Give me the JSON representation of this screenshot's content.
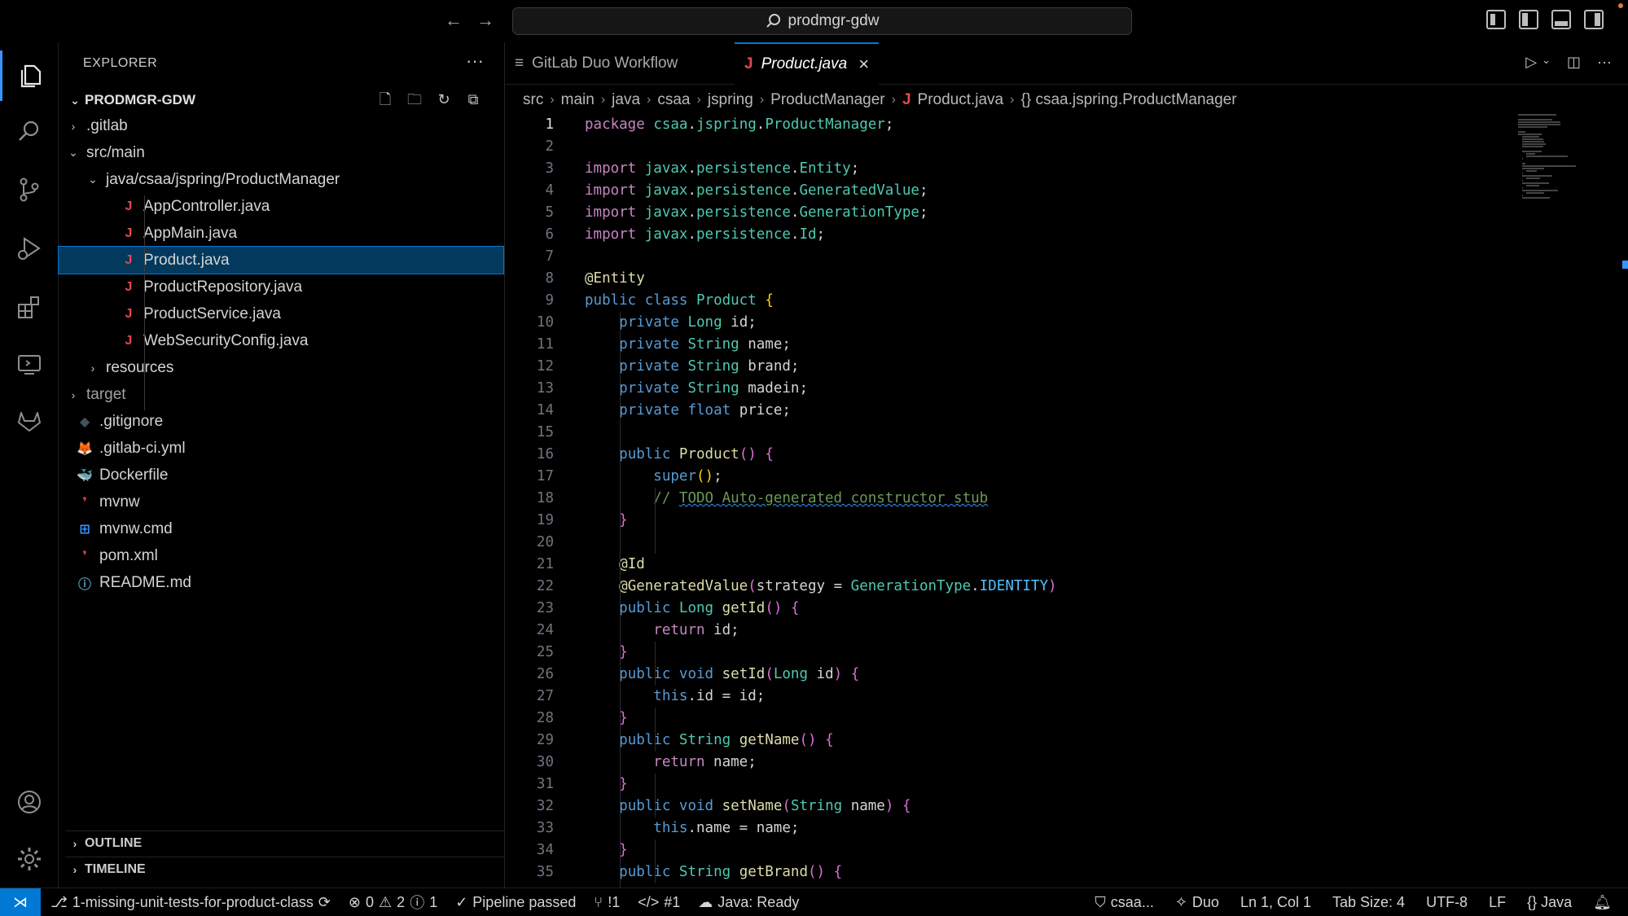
{
  "titlebar": {
    "search_text": "prodmgr-gdw",
    "back": "←",
    "forward": "→"
  },
  "sidebar": {
    "title": "EXPLORER",
    "more": "···",
    "root": "PRODMGR-GDW",
    "tree": [
      {
        "label": ".gitlab",
        "chev": "›",
        "icon": "",
        "icon_color": "",
        "indent": 0,
        "kind": "folder"
      },
      {
        "label": "src/main",
        "chev": "⌄",
        "icon": "",
        "icon_color": "",
        "indent": 0,
        "kind": "folder"
      },
      {
        "label": "java/csaa/jspring/ProductManager",
        "chev": "⌄",
        "icon": "",
        "icon_color": "",
        "indent": 1,
        "kind": "folder"
      },
      {
        "label": "AppController.java",
        "chev": "",
        "icon": "J",
        "icon_color": "#e5484d",
        "indent": 2,
        "kind": "file"
      },
      {
        "label": "AppMain.java",
        "chev": "",
        "icon": "J",
        "icon_color": "#e5484d",
        "indent": 2,
        "kind": "file"
      },
      {
        "label": "Product.java",
        "chev": "",
        "icon": "J",
        "icon_color": "#e5484d",
        "indent": 2,
        "kind": "file",
        "selected": true
      },
      {
        "label": "ProductRepository.java",
        "chev": "",
        "icon": "J",
        "icon_color": "#e5484d",
        "indent": 2,
        "kind": "file"
      },
      {
        "label": "ProductService.java",
        "chev": "",
        "icon": "J",
        "icon_color": "#e5484d",
        "indent": 2,
        "kind": "file"
      },
      {
        "label": "WebSecurityConfig.java",
        "chev": "",
        "icon": "J",
        "icon_color": "#e5484d",
        "indent": 2,
        "kind": "file"
      },
      {
        "label": "resources",
        "chev": "›",
        "icon": "",
        "icon_color": "",
        "indent": 1,
        "kind": "folder"
      },
      {
        "label": "target",
        "chev": "›",
        "icon": "",
        "icon_color": "",
        "indent": 0,
        "kind": "folder",
        "muted": true
      },
      {
        "label": ".gitignore",
        "chev": "",
        "icon": "◆",
        "icon_color": "#41535b",
        "indent": 0,
        "kind": "file"
      },
      {
        "label": ".gitlab-ci.yml",
        "chev": "",
        "icon": "🦊",
        "icon_color": "#e24329",
        "indent": 0,
        "kind": "file"
      },
      {
        "label": "Dockerfile",
        "chev": "",
        "icon": "🐳",
        "icon_color": "#4a90c2",
        "indent": 0,
        "kind": "file"
      },
      {
        "label": "mvnw",
        "chev": "",
        "icon": "❜",
        "icon_color": "#e5484d",
        "indent": 0,
        "kind": "file"
      },
      {
        "label": "mvnw.cmd",
        "chev": "",
        "icon": "⊞",
        "icon_color": "#3794ff",
        "indent": 0,
        "kind": "file"
      },
      {
        "label": "pom.xml",
        "chev": "",
        "icon": "❜",
        "icon_color": "#e5484d",
        "indent": 0,
        "kind": "file"
      },
      {
        "label": "README.md",
        "chev": "",
        "icon": "ⓘ",
        "icon_color": "#519aba",
        "indent": 0,
        "kind": "file"
      }
    ],
    "outline": "OUTLINE",
    "timeline": "TIMELINE"
  },
  "tabs": [
    {
      "label": "GitLab Duo Workflow",
      "icon": "≡",
      "active": false
    },
    {
      "label": "Product.java",
      "icon": "J",
      "active": true
    }
  ],
  "breadcrumb": [
    "src",
    "main",
    "java",
    "csaa",
    "jspring",
    "ProductManager",
    "Product.java",
    "{} csaa.jspring.ProductManager"
  ],
  "code_lines": [
    "<span class='kw2'>package</span> <span class='ty'>csaa</span>.<span class='ty'>jspring</span>.<span class='ty'>ProductManager</span>;",
    "",
    "<span class='kw2'>import</span> <span class='ty'>javax</span>.<span class='ty'>persistence</span>.<span class='ty'>Entity</span>;",
    "<span class='kw2'>import</span> <span class='ty'>javax</span>.<span class='ty'>persistence</span>.<span class='ty'>GeneratedValue</span>;",
    "<span class='kw2'>import</span> <span class='ty'>javax</span>.<span class='ty'>persistence</span>.<span class='ty'>GenerationType</span>;",
    "<span class='kw2'>import</span> <span class='ty'>javax</span>.<span class='ty'>persistence</span>.<span class='ty'>Id</span>;",
    "",
    "<span class='an'>@Entity</span>",
    "<span class='kw'>public</span> <span class='kw'>class</span> <span class='ty'>Product</span> <span class='pu'>{</span>",
    "    <span class='kw'>private</span> <span class='ty'>Long</span> id;",
    "    <span class='kw'>private</span> <span class='ty'>String</span> name;",
    "    <span class='kw'>private</span> <span class='ty'>String</span> brand;",
    "    <span class='kw'>private</span> <span class='ty'>String</span> madein;",
    "    <span class='kw'>private</span> <span class='kw'>float</span> price;",
    "",
    "    <span class='kw'>public</span> <span class='fn'>Product</span><span class='pu2'>()</span> <span class='pu2'>{</span>",
    "        <span class='kw'>super</span><span class='pu'>()</span>;",
    "        <span class='cm'>// <span class='todo'>TODO Auto-generated constructor stub</span></span>",
    "    <span class='pu2'>}</span>",
    "",
    "    <span class='an'>@Id</span>",
    "    <span class='an'>@GeneratedValue</span><span class='pu2'>(</span>strategy = <span class='ty'>GenerationType</span>.<span class='cst'>IDENTITY</span><span class='pu2'>)</span>",
    "    <span class='kw'>public</span> <span class='ty'>Long</span> <span class='fn'>getId</span><span class='pu2'>()</span> <span class='pu2'>{</span>",
    "        <span class='kw2'>return</span> id;",
    "    <span class='pu2'>}</span>",
    "    <span class='kw'>public</span> <span class='kw'>void</span> <span class='fn'>setId</span><span class='pu2'>(</span><span class='ty'>Long</span> id<span class='pu2'>)</span> <span class='pu2'>{</span>",
    "        <span class='kw'>this</span>.id = id;",
    "    <span class='pu2'>}</span>",
    "    <span class='kw'>public</span> <span class='ty'>String</span> <span class='fn'>getName</span><span class='pu2'>()</span> <span class='pu2'>{</span>",
    "        <span class='kw2'>return</span> name;",
    "    <span class='pu2'>}</span>",
    "    <span class='kw'>public</span> <span class='kw'>void</span> <span class='fn'>setName</span><span class='pu2'>(</span><span class='ty'>String</span> name<span class='pu2'>)</span> <span class='pu2'>{</span>",
    "        <span class='kw'>this</span>.name = name;",
    "    <span class='pu2'>}</span>",
    "    <span class='kw'>public</span> <span class='ty'>String</span> <span class='fn'>getBrand</span><span class='pu2'>()</span> <span class='pu2'>{</span>"
  ],
  "status": {
    "branch": "1-missing-unit-tests-for-product-class",
    "errors": "0",
    "warnings": "2",
    "infos": "1",
    "pipeline": "Pipeline passed",
    "mr": "!1",
    "issue": "#1",
    "java_status": "Java: Ready",
    "gitlab_account": "csaa...",
    "duo": "Duo",
    "cursor": "Ln 1, Col 1",
    "tab_size": "Tab Size: 4",
    "encoding": "UTF-8",
    "eol": "LF",
    "language": "{} Java"
  }
}
